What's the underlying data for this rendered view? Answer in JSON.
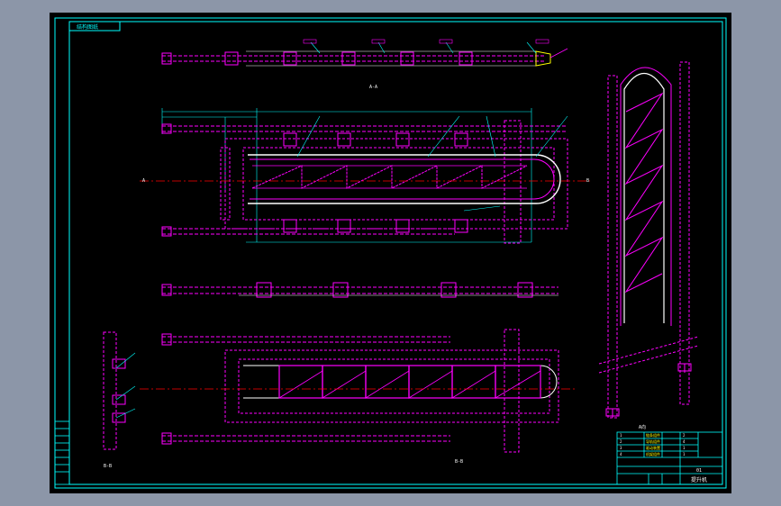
{
  "colors": {
    "background_chrome": "#8c96a8",
    "canvas": "#000000",
    "frame": "#00ffff",
    "geometry": "#ff00ff",
    "dimensions": "#00ffff",
    "centerline": "#ff0000",
    "annotation": "#ffffff",
    "title_block_accent": "#ffff00"
  },
  "drawing": {
    "corner_label": "结构图纸",
    "section_label_top": "A-A",
    "view_label_side": "A向",
    "section_label_bottom": "B-B",
    "label_left_marker": "A",
    "label_right_marker": "B",
    "label_bottom_left": "B-B"
  },
  "title_block": {
    "title": "提升机",
    "drawing_no": "01",
    "rows": [
      {
        "no": "1",
        "name": "链条组件",
        "qty": "2"
      },
      {
        "no": "2",
        "name": "导轨组件",
        "qty": "4"
      },
      {
        "no": "3",
        "name": "驱动装置",
        "qty": "1"
      },
      {
        "no": "4",
        "name": "机架组件",
        "qty": "1"
      }
    ]
  },
  "icons": {
    "section_arrow": "section-arrow-icon",
    "leader": "leader-callout-icon"
  }
}
